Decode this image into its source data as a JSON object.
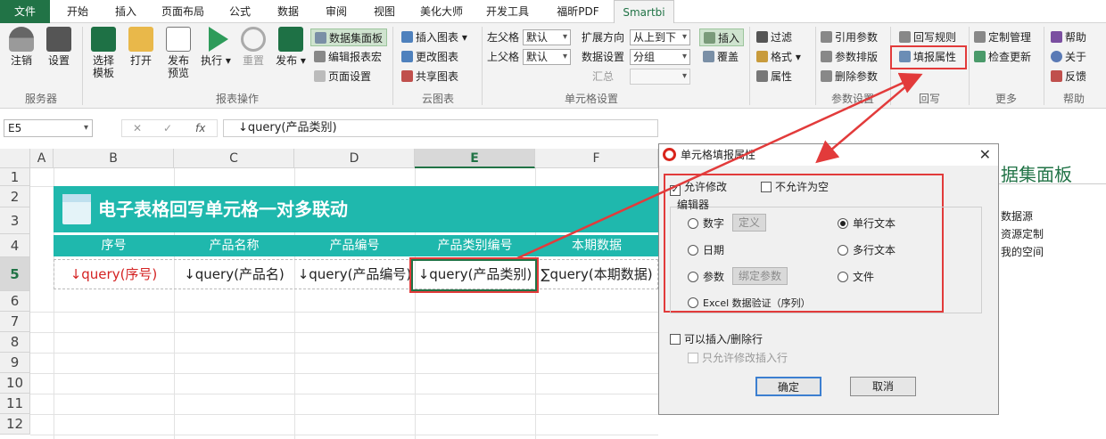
{
  "tabs": [
    "文件",
    "开始",
    "插入",
    "页面布局",
    "公式",
    "数据",
    "审阅",
    "视图",
    "美化大师",
    "开发工具",
    "福昕PDF",
    "Smartbi"
  ],
  "ribbon": {
    "server": {
      "login": "注销",
      "settings": "设置",
      "group": "服务器"
    },
    "report": {
      "select": "选择模板",
      "open": "打开",
      "publish_preview": "发布预览",
      "run": "执行",
      "reset": "重置",
      "publish": "发布",
      "group": "报表操作"
    },
    "panel": {
      "dataset_panel": "数据集面板",
      "edit_macro": "编辑报表宏",
      "page_setup": "页面设置"
    },
    "cloud": {
      "insert_chart": "插入图表",
      "change_chart": "更改图表",
      "share_chart": "共享图表",
      "group": "云图表"
    },
    "cell": {
      "left_parent": "左父格",
      "left_parent_val": "默认",
      "top_parent": "上父格",
      "top_parent_val": "默认",
      "expand_dir": "扩展方向",
      "expand_dir_val": "从上到下",
      "data_setting": "数据设置",
      "data_setting_val": "分组",
      "summary": "汇总",
      "group": "单元格设置"
    },
    "insert": {
      "insert": "插入",
      "cover": "覆盖"
    },
    "param": {
      "filter": "过滤",
      "format": "格式",
      "attr": "属性",
      "ref_param": "引用参数",
      "param_layout": "参数排版",
      "delete_param": "删除参数",
      "group": "参数设置"
    },
    "writeback": {
      "rules": "回写规则",
      "fill_attr": "填报属性",
      "group": "回写"
    },
    "more": {
      "custom": "定制管理",
      "check_update": "检查更新",
      "group": "更多"
    },
    "help": {
      "help": "帮助",
      "about": "关于",
      "feedback": "反馈",
      "group": "帮助"
    }
  },
  "formula_bar": {
    "name_box": "E5",
    "fx": "fx",
    "formula": "↓query(产品类别)"
  },
  "sheet": {
    "columns": [
      "A",
      "B",
      "C",
      "D",
      "E",
      "F"
    ],
    "rows": [
      "1",
      "2",
      "3",
      "4",
      "5",
      "6",
      "7",
      "8",
      "9",
      "10",
      "11",
      "12"
    ],
    "title": "电子表格回写单元格一对多联动",
    "headers": [
      "序号",
      "产品名称",
      "产品编号",
      "产品类别编号",
      "本期数据"
    ],
    "row5": [
      "↓query(序号)",
      "↓query(产品名)",
      "↓query(产品编号)",
      "↓query(产品类别)",
      "∑query(本期数据)"
    ]
  },
  "right_pane": {
    "title": "据集面板",
    "items": [
      "数据源",
      "资源定制",
      "我的空间"
    ]
  },
  "dialog": {
    "title": "单元格填报属性",
    "allow_edit": "允许修改",
    "not_null": "不允许为空",
    "editor_label": "编辑器",
    "number": "数字",
    "define": "定义",
    "date": "日期",
    "param": "参数",
    "bind_param": "绑定参数",
    "excel_validation": "Excel 数据验证（序列）",
    "single_text": "单行文本",
    "multi_text": "多行文本",
    "file": "文件",
    "insert_delete": "可以插入/删除行",
    "only_insert": "只允许修改插入行",
    "ok": "确定",
    "cancel": "取消"
  },
  "colors": {
    "accent": "#217346",
    "teal": "#1fb8ad",
    "highlight": "#e23b3b"
  }
}
